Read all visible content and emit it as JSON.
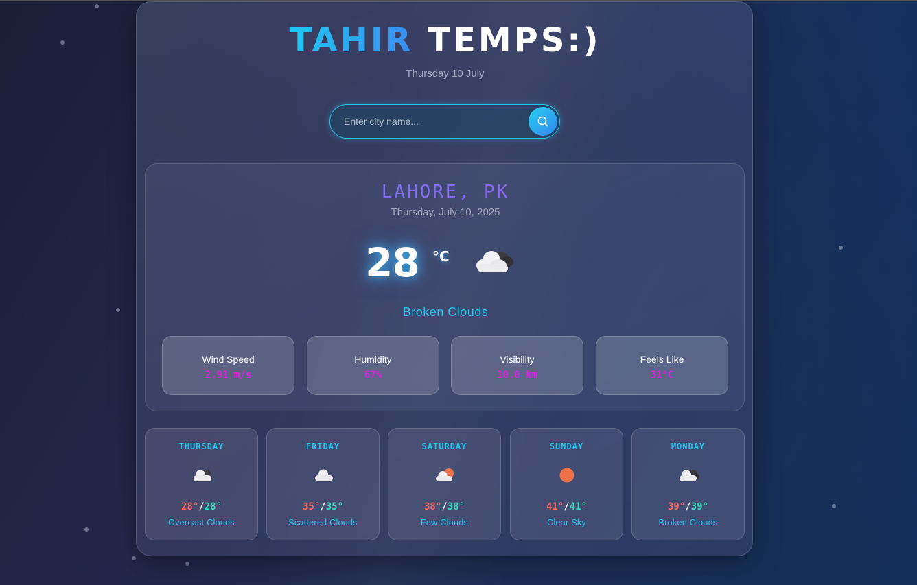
{
  "header": {
    "title_part1": "TAHIR",
    "title_part2": "TEMPS:)",
    "date": "Thursday 10 July"
  },
  "search": {
    "placeholder": "Enter city name...",
    "icon": "search-icon"
  },
  "current": {
    "city": "LAHORE, PK",
    "full_date": "Thursday, July 10, 2025",
    "temperature": "28",
    "unit": "°C",
    "icon": "broken-clouds-icon",
    "description": "Broken Clouds",
    "stats": [
      {
        "label": "Wind Speed",
        "value": "2.91 m/s"
      },
      {
        "label": "Humidity",
        "value": "67%"
      },
      {
        "label": "Visibility",
        "value": "10.0 km"
      },
      {
        "label": "Feels Like",
        "value": "31°C"
      }
    ]
  },
  "forecast": [
    {
      "day": "THURSDAY",
      "high": "28°",
      "sep": "/",
      "low": "28°",
      "desc": "Overcast Clouds",
      "icon": "overcast-clouds-icon"
    },
    {
      "day": "FRIDAY",
      "high": "35°",
      "sep": "/",
      "low": "35°",
      "desc": "Scattered Clouds",
      "icon": "scattered-clouds-icon"
    },
    {
      "day": "SATURDAY",
      "high": "38°",
      "sep": "/",
      "low": "38°",
      "desc": "Few Clouds",
      "icon": "few-clouds-icon"
    },
    {
      "day": "SUNDAY",
      "high": "41°",
      "sep": "/",
      "low": "41°",
      "desc": "Clear Sky",
      "icon": "clear-sky-icon"
    },
    {
      "day": "MONDAY",
      "high": "39°",
      "sep": "/",
      "low": "39°",
      "desc": "Broken Clouds",
      "icon": "broken-clouds-icon"
    }
  ],
  "colors": {
    "accent_cyan": "#1ec6ee",
    "stat_value_magenta": "#e020e0",
    "high_temp": "#f06a6a",
    "low_temp": "#3fd7c0"
  }
}
